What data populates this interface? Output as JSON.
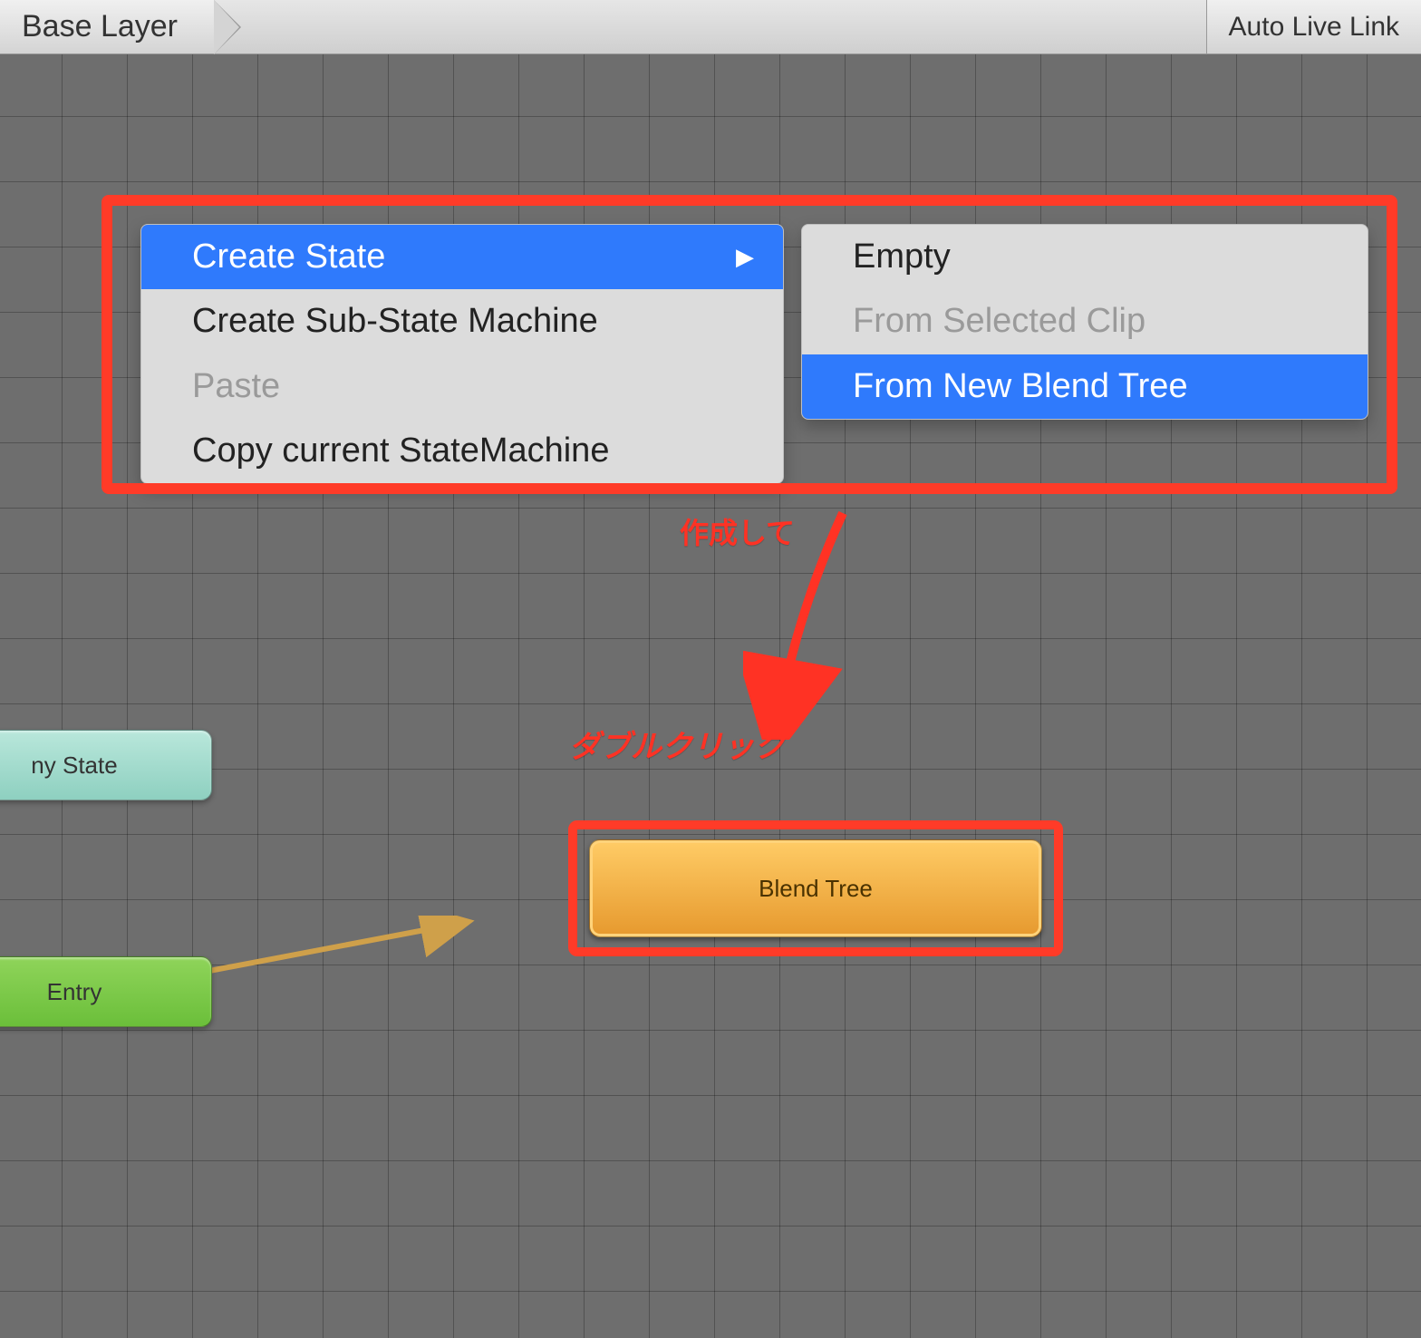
{
  "toolbar": {
    "breadcrumb": "Base Layer",
    "right_button": "Auto Live Link"
  },
  "context_menu": {
    "items": [
      {
        "label": "Create State",
        "has_submenu": true,
        "highlighted": true
      },
      {
        "label": "Create Sub-State Machine"
      },
      {
        "label": "Paste",
        "disabled": true
      },
      {
        "label": "Copy current StateMachine"
      }
    ],
    "submenu": [
      {
        "label": "Empty"
      },
      {
        "label": "From Selected Clip",
        "disabled": true
      },
      {
        "label": "From New Blend Tree",
        "highlighted": true
      }
    ]
  },
  "nodes": {
    "any_state": "ny State",
    "entry": "Entry",
    "blend_tree": "Blend Tree"
  },
  "annotations": {
    "create": "作成して",
    "double_click": "ダブルクリック"
  }
}
